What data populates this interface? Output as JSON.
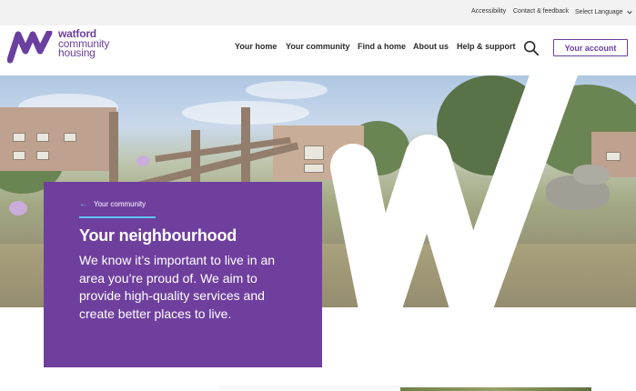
{
  "utility": {
    "accessibility": "Accessibility",
    "contact": "Contact & feedback",
    "language": "Select Language"
  },
  "logo": {
    "line1": "watford",
    "line2": "community",
    "line3": "housing"
  },
  "nav": {
    "items": [
      {
        "label": "Your home"
      },
      {
        "label": "Your community"
      },
      {
        "label": "Find a home"
      },
      {
        "label": "About us"
      },
      {
        "label": "Help & support"
      }
    ],
    "account": "Your account"
  },
  "hero": {
    "breadcrumb": "Your community",
    "title": "Your neighbourhood",
    "body": "We know it’s important to live in an area you’re proud of. We aim to provide high-quality services and create better places to live."
  },
  "colors": {
    "brand_purple": "#6f3f9e",
    "accent_blue": "#5fc4f2",
    "utility_bg": "#f2f2f2"
  },
  "icons": {
    "search": "search-icon",
    "chevron": "chevron-down-icon",
    "back": "arrow-left-icon"
  }
}
